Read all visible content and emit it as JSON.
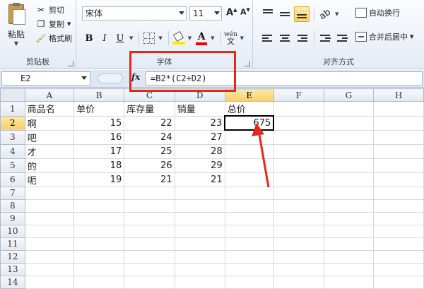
{
  "clipboard": {
    "paste_label": "粘贴",
    "cut_label": "剪切",
    "copy_label": "复制",
    "format_painter_label": "格式刷",
    "group_label": "剪贴板"
  },
  "font": {
    "name": "宋体",
    "size": "11",
    "grow_glyph": "A",
    "shrink_glyph": "A",
    "bold": "B",
    "italic": "I",
    "underline": "U",
    "font_color_glyph": "A",
    "wen_label_top": "wén",
    "wen_label_bottom": "文",
    "group_label": "字体"
  },
  "alignment": {
    "wrap_label": "自动换行",
    "merge_label": "合并后居中",
    "group_label": "对齐方式"
  },
  "formula_bar": {
    "name_box": "E2",
    "fx": "fx",
    "formula": "=B2*(C2+D2)"
  },
  "sheet": {
    "columns": [
      "A",
      "B",
      "C",
      "D",
      "E",
      "F",
      "G",
      "H"
    ],
    "rows": [
      {
        "n": "1",
        "A": "商品名",
        "B": "单价",
        "C": "库存量",
        "D": "销量",
        "E": "总价"
      },
      {
        "n": "2",
        "A": "啊",
        "B": "15",
        "C": "22",
        "D": "23",
        "E": "675"
      },
      {
        "n": "3",
        "A": "吧",
        "B": "16",
        "C": "24",
        "D": "27",
        "E": ""
      },
      {
        "n": "4",
        "A": "才",
        "B": "17",
        "C": "25",
        "D": "28",
        "E": ""
      },
      {
        "n": "5",
        "A": "的",
        "B": "18",
        "C": "26",
        "D": "29",
        "E": ""
      },
      {
        "n": "6",
        "A": "呃",
        "B": "19",
        "C": "21",
        "D": "21",
        "E": ""
      },
      {
        "n": "7"
      },
      {
        "n": "8"
      },
      {
        "n": "9"
      },
      {
        "n": "10"
      },
      {
        "n": "11"
      },
      {
        "n": "12"
      },
      {
        "n": "13"
      },
      {
        "n": "14"
      }
    ],
    "active_cell": "E2"
  },
  "colors": {
    "annotation_red": "#e5261f",
    "fill_yellow": "#ffe800",
    "font_red": "#e00000"
  }
}
